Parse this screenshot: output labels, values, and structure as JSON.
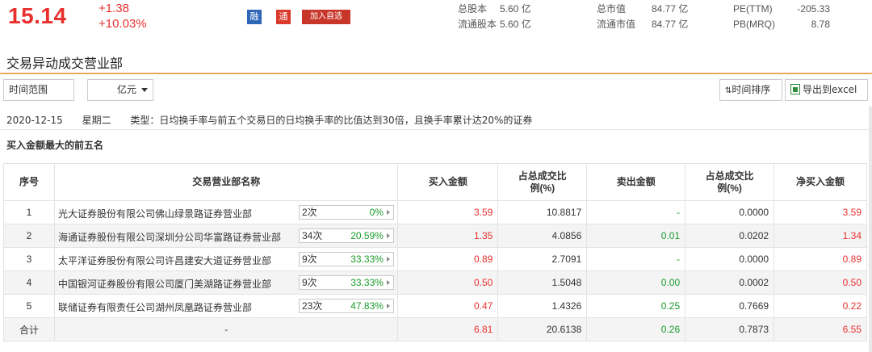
{
  "quote": {
    "price": "15.14",
    "change": "+1.38",
    "change_pct": "+10.03%",
    "badge_rong": "融",
    "badge_tong": "通",
    "add_watch": "加入自选",
    "stats": [
      {
        "label": "总股本",
        "value": "5.60 亿"
      },
      {
        "label": "流通股本",
        "value": "5.60 亿"
      },
      {
        "label": "总市值",
        "value": "84.77 亿"
      },
      {
        "label": "流通市值",
        "value": "84.77 亿"
      },
      {
        "label": "PE(TTM)",
        "value": "-205.33"
      },
      {
        "label": "PB(MRQ)",
        "value": "8.78"
      }
    ],
    "colors": {
      "up": "#e8312f",
      "down": "#1b9b2b",
      "accent": "#e8aa5e"
    }
  },
  "section_title": "交易异动成交营业部",
  "toolbar": {
    "range_label": "时间范围",
    "unit_value": "亿元",
    "sort_label": "时间排序",
    "export_label": "导出到excel"
  },
  "info": {
    "date": "2020-12-15",
    "weekday": "星期二",
    "type": "类型：日均换手率与前五个交易日的日均换手率的比值达到30倍，且换手率累计达20%的证券"
  },
  "subtitle": "买入金额最大的前五名",
  "table": {
    "headers": {
      "no": "序号",
      "name": "交易营业部名称",
      "buy": "买入金额",
      "buy_pct_1": "占总成交比",
      "buy_pct_2": "例(%)",
      "sell": "卖出金额",
      "sell_pct_1": "占总成交比",
      "sell_pct_2": "例(%)",
      "net": "净买入金额"
    },
    "rows": [
      {
        "no": "1",
        "name": "光大证券股份有限公司佛山绿景路证券营业部",
        "times": "2次",
        "rate": "0%",
        "buy": "3.59",
        "buy_pct": "10.8817",
        "sell": "-",
        "sell_pct": "0.0000",
        "net": "3.59"
      },
      {
        "no": "2",
        "name": "海通证券股份有限公司深圳分公司华富路证券营业部",
        "times": "34次",
        "rate": "20.59%",
        "buy": "1.35",
        "buy_pct": "4.0856",
        "sell": "0.01",
        "sell_pct": "0.0202",
        "net": "1.34"
      },
      {
        "no": "3",
        "name": "太平洋证券股份有限公司许昌建安大道证券营业部",
        "times": "9次",
        "rate": "33.33%",
        "buy": "0.89",
        "buy_pct": "2.7091",
        "sell": "-",
        "sell_pct": "0.0000",
        "net": "0.89"
      },
      {
        "no": "4",
        "name": "中国银河证券股份有限公司厦门美湖路证券营业部",
        "times": "9次",
        "rate": "33.33%",
        "buy": "0.50",
        "buy_pct": "1.5048",
        "sell": "0.00",
        "sell_pct": "0.0002",
        "net": "0.50"
      },
      {
        "no": "5",
        "name": "联储证券有限责任公司湖州凤凰路证券营业部",
        "times": "23次",
        "rate": "47.83%",
        "buy": "0.47",
        "buy_pct": "1.4326",
        "sell": "0.25",
        "sell_pct": "0.7669",
        "net": "0.22"
      }
    ],
    "total": {
      "label": "合计",
      "name": "-",
      "buy": "6.81",
      "buy_pct": "20.6138",
      "sell": "0.26",
      "sell_pct": "0.7873",
      "net": "6.55"
    }
  }
}
